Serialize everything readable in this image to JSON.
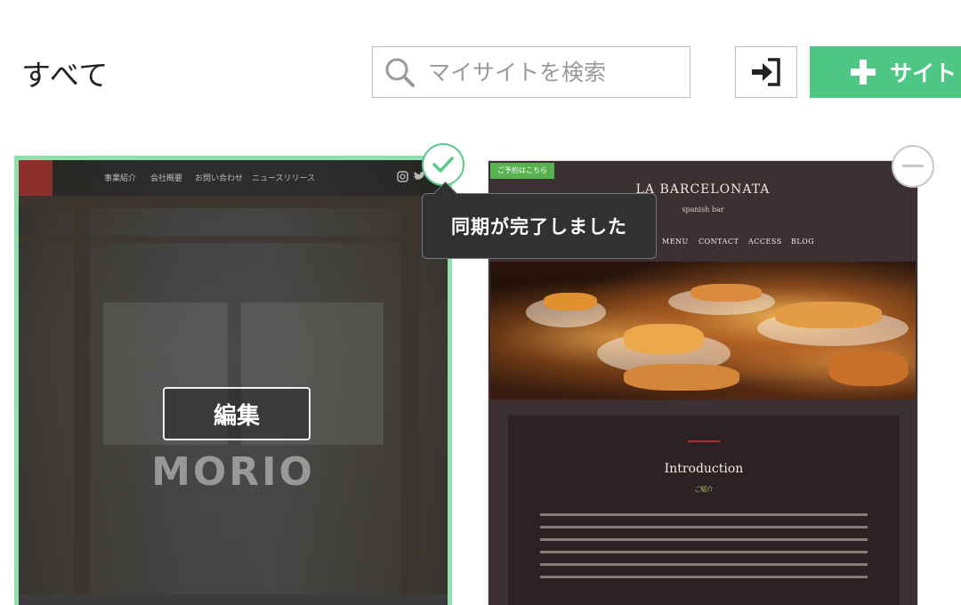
{
  "header": {
    "title": "すべて",
    "search_placeholder": "マイサイトを検索",
    "add_site_label": "サイト"
  },
  "sites": [
    {
      "preview_nav": [
        "事業紹介",
        "会社概要",
        "お問い合わせ",
        "ニュースリリース"
      ],
      "preview_brand": "MORIO",
      "edit_label": "編集",
      "sync_tooltip": "同期が完了しました",
      "sync_status": "synced"
    },
    {
      "preview_badge": "ご予約はこちら",
      "preview_brand": "LA BARCELONATA",
      "preview_brand_sub": "spanish bar",
      "preview_nav": [
        "MENU",
        "CONTACT",
        "ACCESS",
        "BLOG"
      ],
      "preview_intro_title": "Introduction",
      "preview_intro_sub": "ご紹介"
    }
  ],
  "icons": {
    "search": "search-icon",
    "import": "sign-in-icon",
    "add": "plus-icon",
    "synced": "check-icon",
    "remove": "minus-icon"
  },
  "colors": {
    "accent": "#4ec784",
    "selected_border": "#8ee0ac",
    "tooltip_bg": "#2f3133"
  }
}
